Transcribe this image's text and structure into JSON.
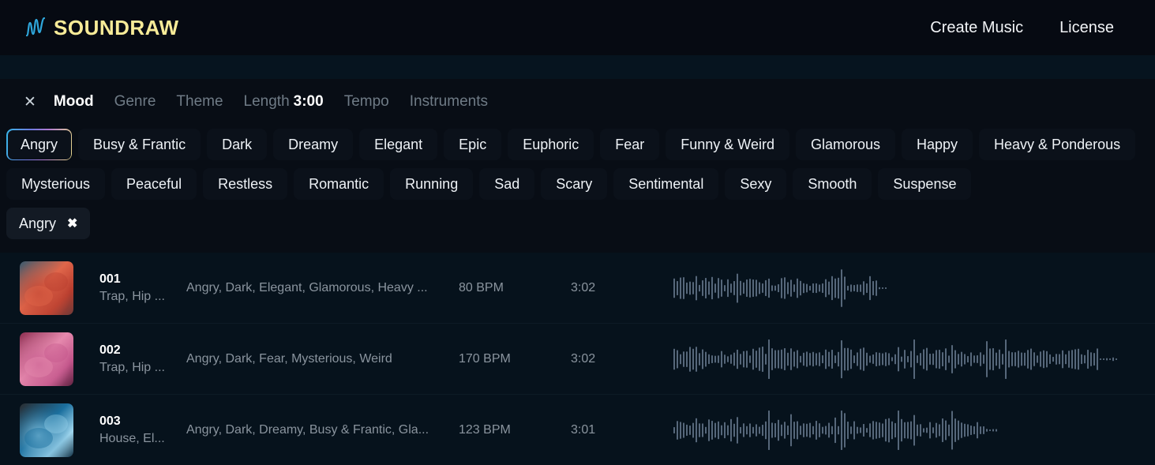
{
  "header": {
    "logo_icon": "soundwave-logo-icon",
    "logo_text": "SOUNDRAW",
    "nav": [
      {
        "label": "Create Music"
      },
      {
        "label": "License"
      }
    ]
  },
  "filter_panel": {
    "close_icon": "close-icon",
    "tabs": [
      {
        "label": "Mood",
        "active": true
      },
      {
        "label": "Genre",
        "active": false
      },
      {
        "label": "Theme",
        "active": false
      },
      {
        "label": "Length",
        "value": "3:00",
        "active": false
      },
      {
        "label": "Tempo",
        "active": false
      },
      {
        "label": "Instruments",
        "active": false
      }
    ],
    "chips_row1": [
      {
        "label": "Angry",
        "selected": true
      },
      {
        "label": "Busy & Frantic",
        "selected": false
      },
      {
        "label": "Dark",
        "selected": false
      },
      {
        "label": "Dreamy",
        "selected": false
      },
      {
        "label": "Elegant",
        "selected": false
      },
      {
        "label": "Epic",
        "selected": false
      },
      {
        "label": "Euphoric",
        "selected": false
      },
      {
        "label": "Fear",
        "selected": false
      },
      {
        "label": "Funny & Weird",
        "selected": false
      },
      {
        "label": "Glamorous",
        "selected": false
      },
      {
        "label": "Happy",
        "selected": false
      },
      {
        "label": "Heavy & Ponderous",
        "selected": false
      }
    ],
    "chips_row2": [
      {
        "label": "Mysterious",
        "selected": false
      },
      {
        "label": "Peaceful",
        "selected": false
      },
      {
        "label": "Restless",
        "selected": false
      },
      {
        "label": "Romantic",
        "selected": false
      },
      {
        "label": "Running",
        "selected": false
      },
      {
        "label": "Sad",
        "selected": false
      },
      {
        "label": "Scary",
        "selected": false
      },
      {
        "label": "Sentimental",
        "selected": false
      },
      {
        "label": "Sexy",
        "selected": false
      },
      {
        "label": "Smooth",
        "selected": false
      },
      {
        "label": "Suspense",
        "selected": false
      }
    ],
    "selected_tags": [
      {
        "label": "Angry",
        "remove_icon": "remove-tag-icon",
        "remove_glyph": "✖"
      }
    ]
  },
  "tracks": [
    {
      "title": "001",
      "genre": "Trap, Hip ...",
      "tags": "Angry, Dark, Elegant, Glamorous, Heavy ...",
      "bpm": "80 BPM",
      "duration": "3:02",
      "thumb_colors": [
        "#3a5a6e",
        "#e0664a",
        "#b83d2e",
        "#6d3a38"
      ],
      "wave_width": 275,
      "wave_seed": 11
    },
    {
      "title": "002",
      "genre": "Trap, Hip ...",
      "tags": "Angry, Dark, Fear, Mysterious, Weird",
      "bpm": "170 BPM",
      "duration": "3:02",
      "thumb_colors": [
        "#8e2f52",
        "#e589ad",
        "#c2548a",
        "#5d2340"
      ],
      "wave_width": 565,
      "wave_seed": 23
    },
    {
      "title": "003",
      "genre": "House, El...",
      "tags": "Angry, Dark, Dreamy, Busy & Frantic, Gla...",
      "bpm": "123 BPM",
      "duration": "3:01",
      "thumb_colors": [
        "#2a2c30",
        "#1b6f9e",
        "#9fd6ee",
        "#123246"
      ],
      "wave_width": 412,
      "wave_seed": 37
    }
  ],
  "colors": {
    "page_bg": "#06121c",
    "header_bg": "#060a12",
    "panel_bg": "#080d15",
    "chip_bg": "#0b111a",
    "accent_yellow": "#f7eb98",
    "accent_blue": "#37b6e8",
    "text_muted": "#8a949e",
    "waveform": "#56677a"
  }
}
